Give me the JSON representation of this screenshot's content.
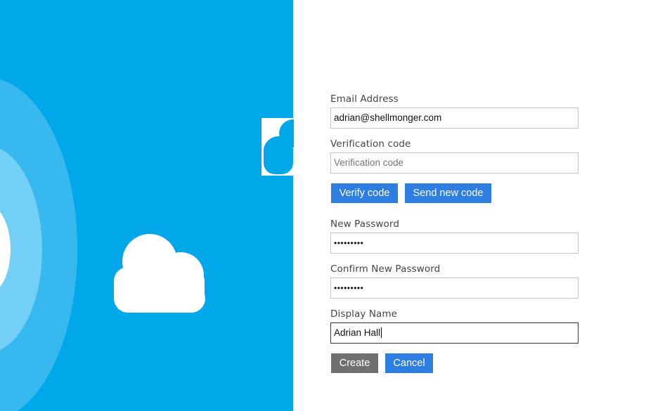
{
  "form": {
    "email": {
      "label": "Email Address",
      "value": "adrian@shellmonger.com"
    },
    "verification": {
      "label": "Verification code",
      "placeholder": "Verification code"
    },
    "verify_button": "Verify code",
    "send_new_code_button": "Send new code",
    "new_password": {
      "label": "New Password",
      "masked_value": "•••••••••"
    },
    "confirm_password": {
      "label": "Confirm New Password",
      "masked_value": "•••••••••"
    },
    "display_name": {
      "label": "Display Name",
      "value": "Adrian Hall"
    },
    "create_button": "Create",
    "cancel_button": "Cancel"
  },
  "colors": {
    "sky": "#00a8ea",
    "ring_outer": "#37b9ef",
    "ring_inner": "#72cff5",
    "cloud": "#ffffff",
    "primary_button": "#2e7de0",
    "disabled_button": "#707070"
  }
}
